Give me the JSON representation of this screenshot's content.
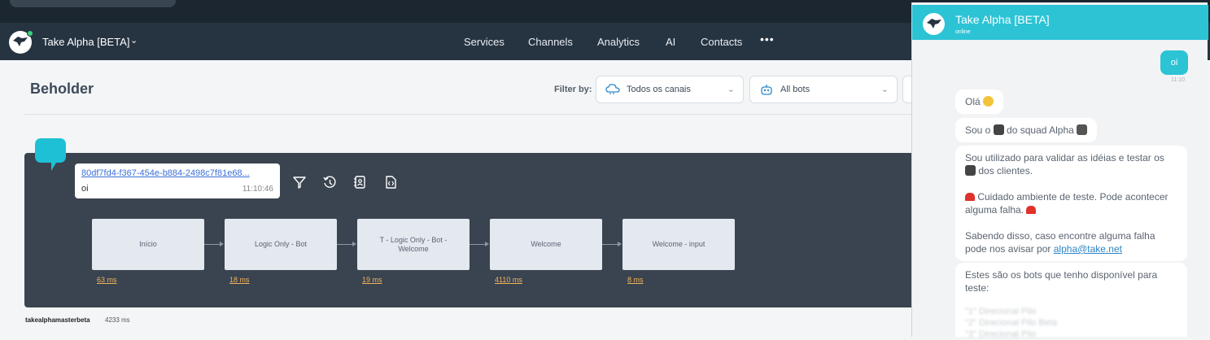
{
  "app": {
    "name": "Take Alpha [BETA]"
  },
  "nav": {
    "items": [
      "Services",
      "Channels",
      "Analytics",
      "AI",
      "Contacts"
    ],
    "more": "•••"
  },
  "page": {
    "title": "Beholder"
  },
  "filters": {
    "label": "Filter by:",
    "channel": "Todos os canais",
    "bot": "All bots"
  },
  "trace": {
    "message_id": "80df7fd4-f367-454e-b884-2498c7f81e68...",
    "message_text": "oi",
    "message_time": "11:10:46",
    "nodes": [
      {
        "label": "Início",
        "ms": "63 ms"
      },
      {
        "label": "Logic Only - Bot",
        "ms": "18 ms"
      },
      {
        "label": "T - Logic Only - Bot - Welcome",
        "ms": "19 ms"
      },
      {
        "label": "Welcome",
        "ms": "4110 ms"
      },
      {
        "label": "Welcome - input",
        "ms": "8 ms"
      }
    ],
    "footer_name": "takealphamasterbeta",
    "footer_ms": "4233 ms"
  },
  "chat": {
    "title": "Take Alpha [BETA]",
    "status": "online",
    "outgoing": {
      "text": "oi",
      "time": "11:10"
    },
    "incoming": {
      "m1": "Olá",
      "m2a": "Sou o",
      "m2b": "do squad Alpha",
      "m3a": "Sou utilizado para validar as idéias e testar os",
      "m3b": "dos clientes.",
      "m3c": "Cuidado ambiente de teste. Pode acontecer alguma falha.",
      "m3d": "Sabendo disso, caso encontre alguma falha pode nos avisar por",
      "m3link": "alpha@take.net",
      "m4": "Estes são os bots que tenho disponível para teste:"
    }
  },
  "colors": {
    "accent": "#2cc3d5",
    "navbar": "#263341",
    "card": "#3a4450",
    "duration": "#f0b35a"
  }
}
